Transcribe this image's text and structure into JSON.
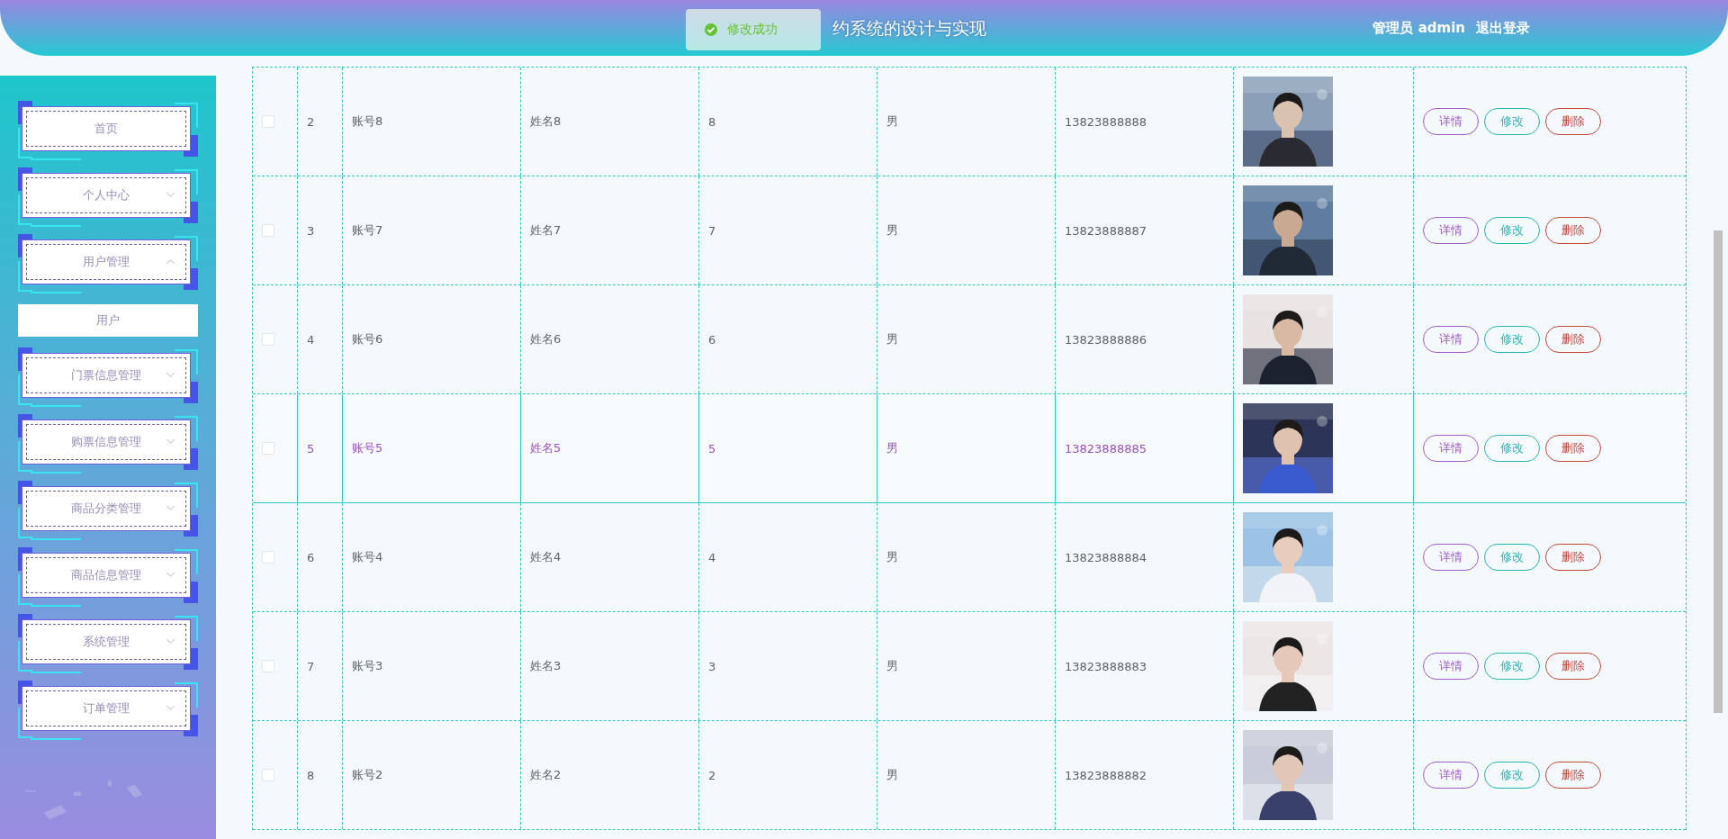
{
  "header": {
    "toast": {
      "message": "修改成功",
      "kind": "success"
    },
    "title": "约系统的设计与实现",
    "user": "管理员 admin",
    "logout": "退出登录"
  },
  "sidebar": {
    "items": [
      {
        "label": "首页",
        "kind": "link"
      },
      {
        "label": "个人中心",
        "kind": "menu",
        "expanded": false
      },
      {
        "label": "用户管理",
        "kind": "menu",
        "expanded": true,
        "children": [
          {
            "label": "用户",
            "kind": "link"
          }
        ]
      },
      {
        "label": "门票信息管理",
        "kind": "menu",
        "expanded": false
      },
      {
        "label": "购票信息管理",
        "kind": "menu",
        "expanded": false
      },
      {
        "label": "商品分类管理",
        "kind": "menu",
        "expanded": false
      },
      {
        "label": "商品信息管理",
        "kind": "menu",
        "expanded": false
      },
      {
        "label": "系统管理",
        "kind": "menu",
        "expanded": false
      },
      {
        "label": "订单管理",
        "kind": "menu",
        "expanded": false
      }
    ]
  },
  "table": {
    "rows": [
      {
        "index": "2",
        "account": "账号8",
        "name": "姓名8",
        "age": "8",
        "sex": "男",
        "phone": "13823888888",
        "checked": false,
        "selected": false,
        "actions": [
          "详情",
          "修改",
          "删除"
        ]
      },
      {
        "index": "3",
        "account": "账号7",
        "name": "姓名7",
        "age": "7",
        "sex": "男",
        "phone": "13823888887",
        "checked": false,
        "selected": false,
        "actions": [
          "详情",
          "修改",
          "删除"
        ]
      },
      {
        "index": "4",
        "account": "账号6",
        "name": "姓名6",
        "age": "6",
        "sex": "男",
        "phone": "13823888886",
        "checked": false,
        "selected": false,
        "actions": [
          "详情",
          "修改",
          "删除"
        ]
      },
      {
        "index": "5",
        "account": "账号5",
        "name": "姓名5",
        "age": "5",
        "sex": "男",
        "phone": "13823888885",
        "checked": false,
        "selected": true,
        "actions": [
          "详情",
          "修改",
          "删除"
        ]
      },
      {
        "index": "6",
        "account": "账号4",
        "name": "姓名4",
        "age": "4",
        "sex": "男",
        "phone": "13823888884",
        "checked": false,
        "selected": false,
        "actions": [
          "详情",
          "修改",
          "删除"
        ]
      },
      {
        "index": "7",
        "account": "账号3",
        "name": "姓名3",
        "age": "3",
        "sex": "男",
        "phone": "13823888883",
        "checked": false,
        "selected": false,
        "actions": [
          "详情",
          "修改",
          "删除"
        ]
      },
      {
        "index": "8",
        "account": "账号2",
        "name": "姓名2",
        "age": "2",
        "sex": "男",
        "phone": "13823888882",
        "checked": false,
        "selected": false,
        "actions": [
          "详情",
          "修改",
          "删除"
        ]
      }
    ]
  }
}
